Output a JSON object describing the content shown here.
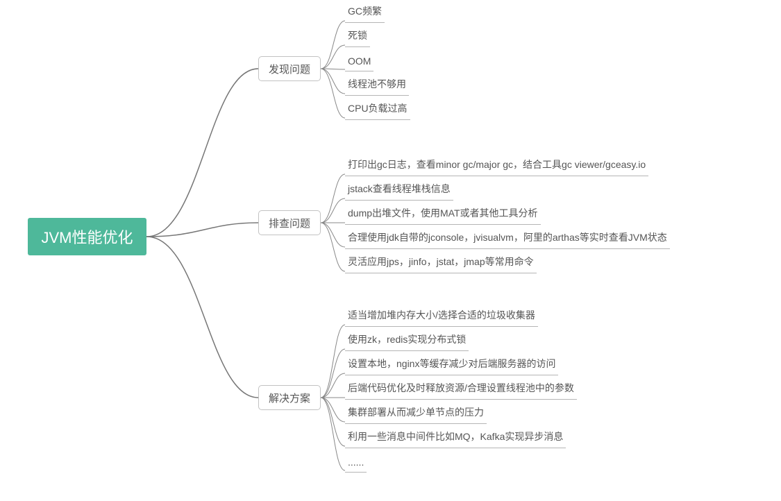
{
  "root": {
    "label": "JVM性能优化"
  },
  "branches": [
    {
      "label": "发现问题",
      "leaves": [
        "GC频繁",
        "死锁",
        "OOM",
        "线程池不够用",
        "CPU负载过高"
      ]
    },
    {
      "label": "排查问题",
      "leaves": [
        "打印出gc日志，查看minor gc/major gc，结合工具gc viewer/gceasy.io",
        "jstack查看线程堆栈信息",
        "dump出堆文件，使用MAT或者其他工具分析",
        "合理使用jdk自带的jconsole，jvisualvm，阿里的arthas等实时查看JVM状态",
        "灵活应用jps，jinfo，jstat，jmap等常用命令"
      ]
    },
    {
      "label": "解决方案",
      "leaves": [
        "适当增加堆内存大小/选择合适的垃圾收集器",
        "使用zk，redis实现分布式锁",
        "设置本地，nginx等缓存减少对后端服务器的访问",
        "后端代码优化及时释放资源/合理设置线程池中的参数",
        "集群部署从而减少单节点的压力",
        "利用一些消息中间件比如MQ，Kafka实现异步消息",
        "......"
      ]
    }
  ]
}
